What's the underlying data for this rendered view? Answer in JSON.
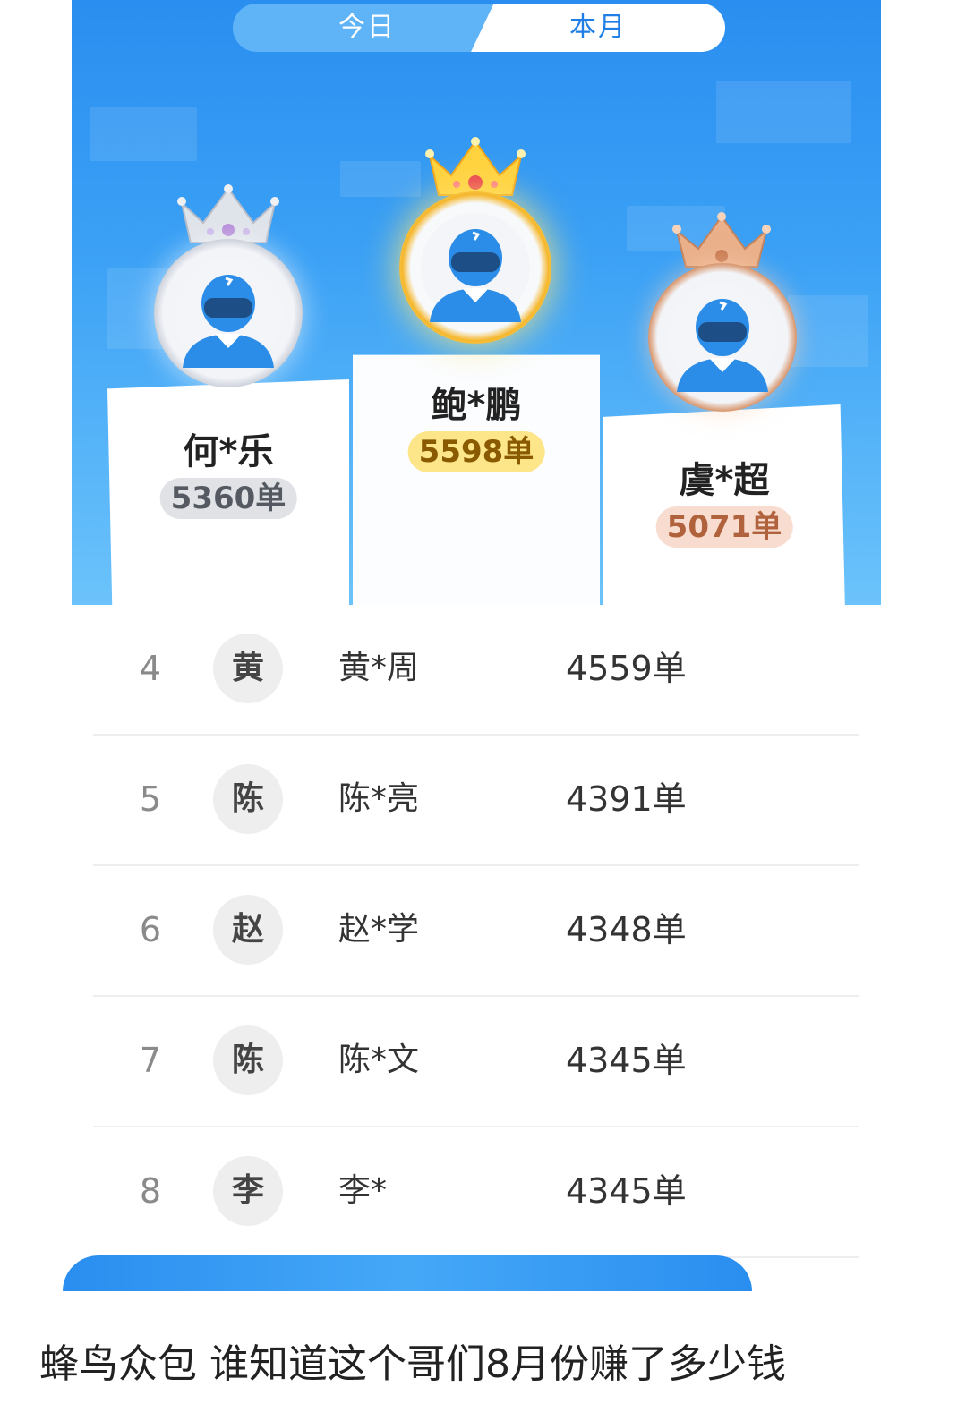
{
  "tabs": {
    "today": "今日",
    "month": "本月",
    "active": "本月"
  },
  "podium": {
    "first": {
      "name": "鲍*鹏",
      "count": "5598单"
    },
    "second": {
      "name": "何*乐",
      "count": "5360单"
    },
    "third": {
      "name": "虞*超",
      "count": "5071单"
    }
  },
  "ranking": [
    {
      "rank": "4",
      "surname": "黄",
      "name": "黄*周",
      "count": "4559单"
    },
    {
      "rank": "5",
      "surname": "陈",
      "name": "陈*亮",
      "count": "4391单"
    },
    {
      "rank": "6",
      "surname": "赵",
      "name": "赵*学",
      "count": "4348单"
    },
    {
      "rank": "7",
      "surname": "陈",
      "name": "陈*文",
      "count": "4345单"
    },
    {
      "rank": "8",
      "surname": "李",
      "name": "李*",
      "count": "4345单"
    }
  ],
  "caption": "蜂鸟众包 谁知道这个哥们8月份赚了多少钱",
  "colors": {
    "brand_blue": "#2a8ef0",
    "gold": "#f5b72c",
    "silver": "#c7ccd6",
    "bronze": "#d99a73"
  }
}
